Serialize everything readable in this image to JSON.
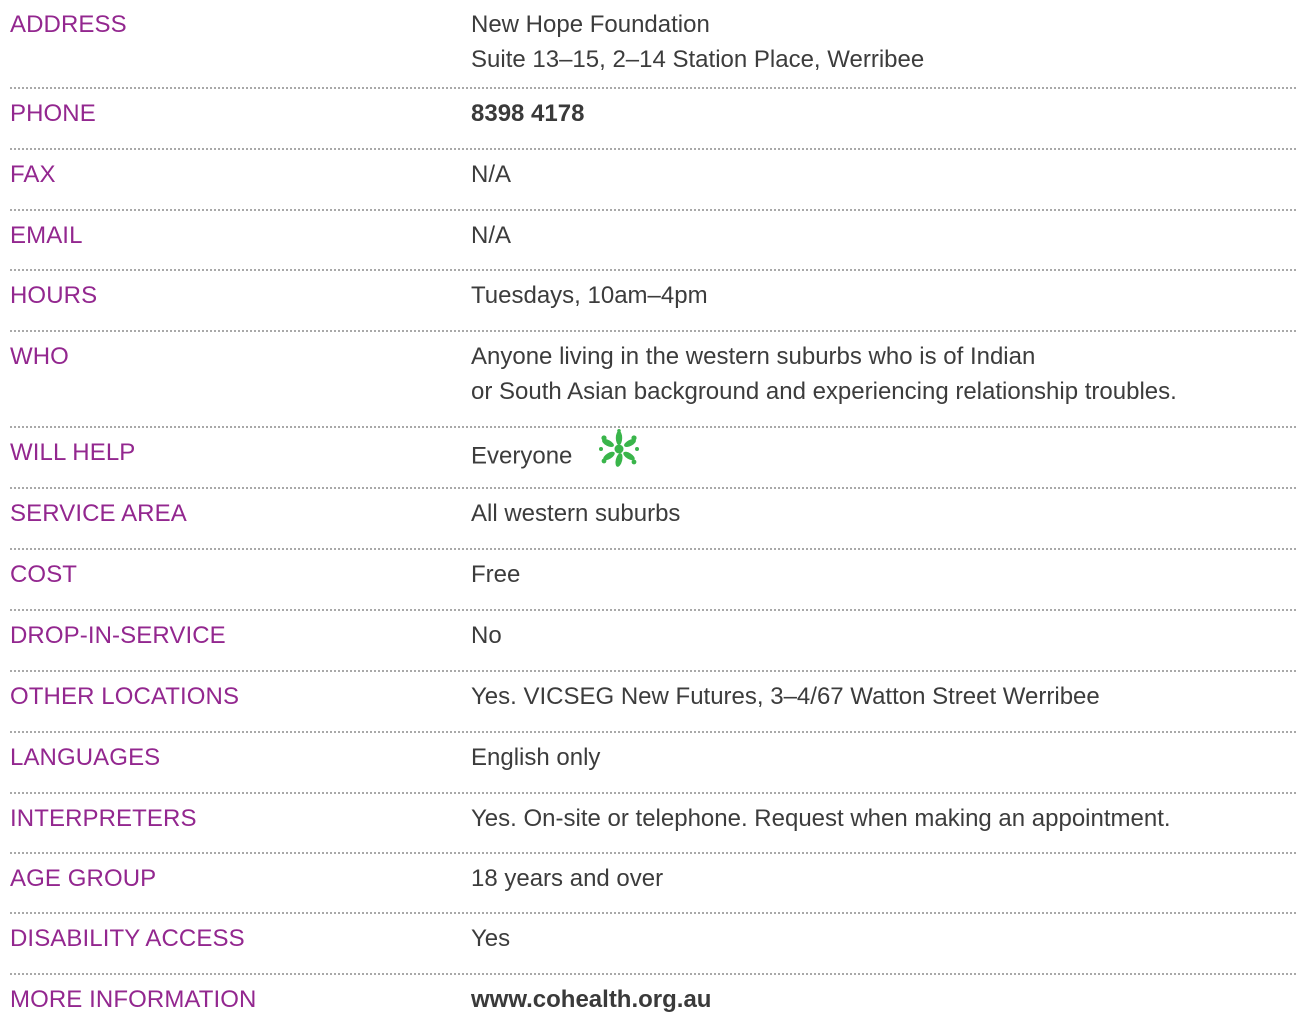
{
  "colors": {
    "label": "#93278f",
    "value": "#3c3c3c",
    "divider": "#a9a9a9",
    "flower": "#39b54a"
  },
  "rows": [
    {
      "label": "ADDRESS",
      "value_lines": [
        "New Hope Foundation",
        "Suite 13–15, 2–14 Station Place, Werribee"
      ]
    },
    {
      "label": "PHONE",
      "value": "8398 4178"
    },
    {
      "label": "FAX",
      "value": "N/A"
    },
    {
      "label": "EMAIL",
      "value": "N/A"
    },
    {
      "label": "HOURS",
      "value": "Tuesdays, 10am–4pm"
    },
    {
      "label": "WHO",
      "value_lines": [
        "Anyone living in the western suburbs who is of Indian",
        "or South Asian background and experiencing relationship troubles."
      ]
    },
    {
      "label": "WILL HELP",
      "value": "Everyone",
      "icon": "green-flower-icon"
    },
    {
      "label": "SERVICE AREA",
      "value": "All western suburbs"
    },
    {
      "label": "COST",
      "value": "Free"
    },
    {
      "label": "DROP-IN-SERVICE",
      "value": "No"
    },
    {
      "label": "OTHER LOCATIONS",
      "value": "Yes. VICSEG New Futures, 3–4/67 Watton Street Werribee"
    },
    {
      "label": "LANGUAGES",
      "value": "English only"
    },
    {
      "label": "INTERPRETERS",
      "value": "Yes. On-site or telephone. Request when making an appointment."
    },
    {
      "label": "AGE GROUP",
      "value": "18 years and over"
    },
    {
      "label": "DISABILITY ACCESS",
      "value": "Yes"
    },
    {
      "label": "MORE INFORMATION",
      "value": "www.cohealth.org.au"
    }
  ]
}
